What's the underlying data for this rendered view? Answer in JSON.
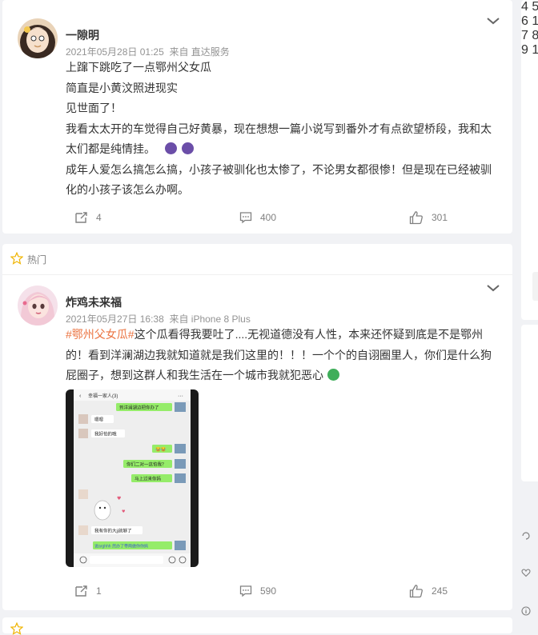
{
  "posts": [
    {
      "username": "一隙明",
      "timestamp": "2021年05月28日 01:25",
      "source": "来自 直达服务",
      "lines": [
        "上蹿下跳吃了一点鄂州父女瓜",
        "简直是小黄汶照进现实",
        "见世面了！",
        "我看太太开的车觉得自己好黄暴，现在想想一篇小说写到番外才有点欲望桥段，我和太",
        "太们都是纯情挂。",
        "成年人爱怎么搞怎么搞，小孩子被驯化也太惨了，不论男女都很惨！但是现在已经被驯",
        "化的小孩子该怎么办啊。"
      ],
      "inline_emojis": [
        "purple-face-emoji",
        "purple-face-emoji"
      ],
      "reposts": "4",
      "comments": "400",
      "likes": "301"
    },
    {
      "badge": "热门",
      "username": "炸鸡未来福",
      "timestamp": "2021年05月27日 16:38",
      "source": "来自 iPhone 8 Plus",
      "hashtag": "#鄂州父女瓜#",
      "text_after_hashtag": "这个瓜看得我要吐了....无视道德没有人性，本来还怀疑到底是不是鄂州",
      "lines": [
        "的！看到洋澜湖边我就知道就是我们这里的！！！一个个的自诩圈里人，你们是什么狗",
        "屁圈子，想到这群人和我生活在一个城市我就犯恶心"
      ],
      "inline_emojis": [
        "vomit-face-emoji"
      ],
      "image": {
        "chat_title": "幸福一家人(3)",
        "messages": [
          "到洋澜湖边把你办了",
          "嗯嗯",
          "我好怕的哦",
          "😂😂",
          "你们二对一这怕我？",
          "马上过来你妈",
          "我有你的大jj就够了",
          "说arghhh 然办了带两做你你妈"
        ]
      },
      "reposts": "1",
      "comments": "590",
      "likes": "245"
    }
  ],
  "sidebar_ranks": [
    "4",
    "5",
    "6",
    "1",
    "7",
    "8",
    "9",
    "1"
  ],
  "colors": {
    "accent": "#ff8200",
    "hashtag": "#eb7340",
    "meta": "#939393",
    "background": "#f1f2f5"
  }
}
